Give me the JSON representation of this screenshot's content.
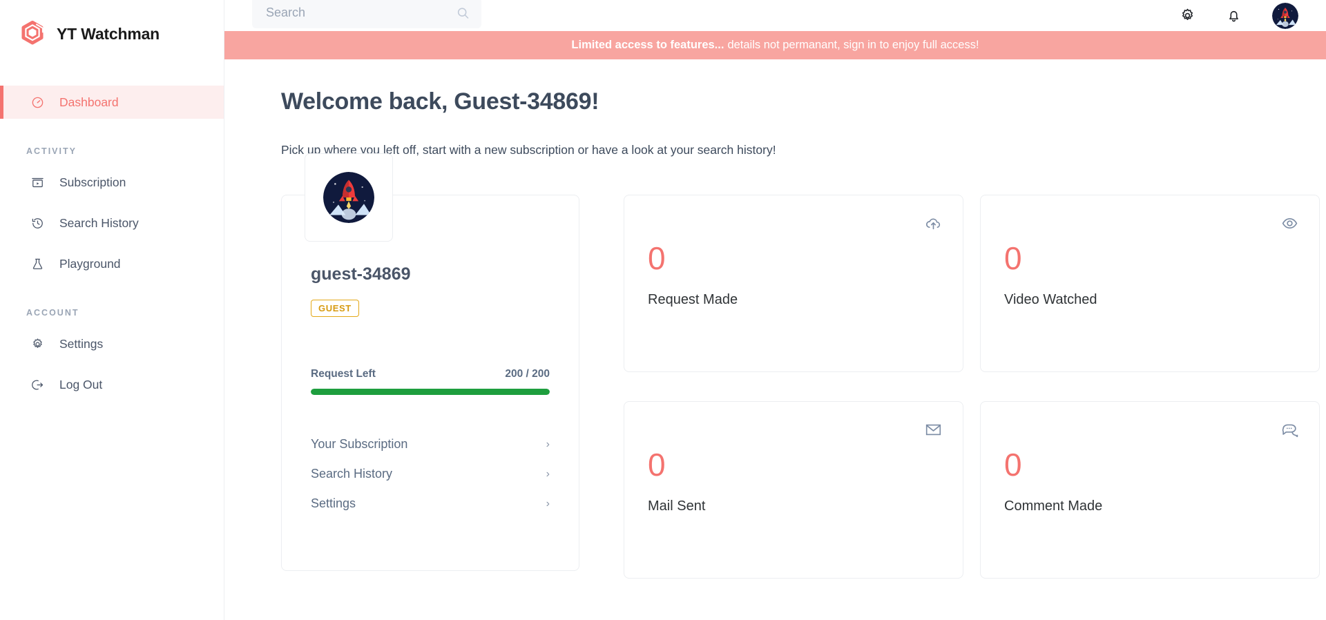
{
  "brand": {
    "name": "YT Watchman",
    "logo_color": "#f4736f"
  },
  "search": {
    "placeholder": "Search",
    "value": "",
    "icon": "search-icon"
  },
  "topbar": {
    "settings_icon": "gear-icon",
    "notifications_icon": "bell-icon",
    "avatar_icon": "rocket-avatar"
  },
  "banner": {
    "bold_text": "Limited access to features...",
    "rest_text": "details not permanant, sign in to enjoy full access!",
    "background": "#f8a5a0"
  },
  "sidebar": {
    "primary": [
      {
        "label": "Dashboard",
        "icon": "dashboard-gauge-icon",
        "active": true
      }
    ],
    "groups": [
      {
        "title": "ACTIVITY",
        "items": [
          {
            "label": "Subscription",
            "icon": "subscription-box-icon"
          },
          {
            "label": "Search History",
            "icon": "history-clock-icon"
          },
          {
            "label": "Playground",
            "icon": "flask-icon"
          }
        ]
      },
      {
        "title": "ACCOUNT",
        "items": [
          {
            "label": "Settings",
            "icon": "gear-icon"
          },
          {
            "label": "Log Out",
            "icon": "logout-icon"
          }
        ]
      }
    ]
  },
  "main": {
    "welcome_title": "Welcome back, Guest-34869!",
    "welcome_subtitle": "Pick up where you left off, start with a new subscription or have a look at your search history!"
  },
  "profile": {
    "avatar_icon": "rocket-avatar",
    "username": "guest-34869",
    "badge": "GUEST",
    "request_label": "Request Left",
    "request_value": "200 / 200",
    "request_percent": 100,
    "progress_color": "#1e9e3e",
    "links": [
      {
        "label": "Your Subscription",
        "chevron": "›"
      },
      {
        "label": "Search History",
        "chevron": "›"
      },
      {
        "label": "Settings",
        "chevron": "›"
      }
    ]
  },
  "stats": [
    {
      "value": "0",
      "label": "Request Made",
      "icon": "cloud-upload-icon",
      "value_color": "#f4736f"
    },
    {
      "value": "0",
      "label": "Video Watched",
      "icon": "eye-icon",
      "value_color": "#f4736f"
    },
    {
      "value": "0",
      "label": "Mail Sent",
      "icon": "mail-icon",
      "value_color": "#f4736f"
    },
    {
      "value": "0",
      "label": "Comment Made",
      "icon": "chat-bubble-icon",
      "value_color": "#f4736f"
    }
  ]
}
